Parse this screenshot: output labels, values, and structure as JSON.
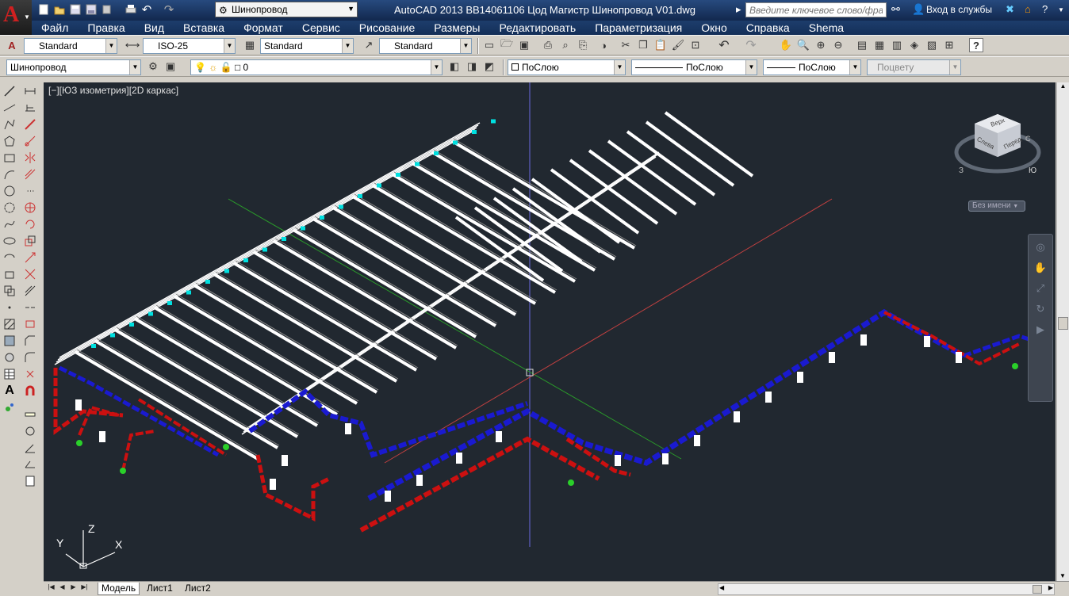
{
  "titlebar": {
    "workspace": "Шинопровод",
    "title": "AutoCAD 2013    BB14061106 Цод Магистр Шинопровод V01.dwg",
    "search_placeholder": "Введите ключевое слово/фразу",
    "sign_in": "Вход в службы"
  },
  "menu": [
    "Файл",
    "Правка",
    "Вид",
    "Вставка",
    "Формат",
    "Сервис",
    "Рисование",
    "Размеры",
    "Редактировать",
    "Параметризация",
    "Окно",
    "Справка",
    "Shema"
  ],
  "styles": {
    "text_style": "Standard",
    "dim_style": "ISO-25",
    "table_style": "Standard",
    "mleader_style": "Standard"
  },
  "layers": {
    "layer_name": "Шинопровод",
    "layer_current": "0",
    "color": "ПоСлою",
    "linetype": "ПоСлою",
    "lineweight": "ПоСлою",
    "plotstyle": "Поцвету"
  },
  "viewport": {
    "label": "[−][ЮЗ изометрия][2D каркас]",
    "viewcube": {
      "top": "Верх",
      "left": "Слева",
      "front": "Перед",
      "compass_s": "С",
      "compass_w": "З",
      "compass_sw": "Ю"
    },
    "named_view": "Без имени",
    "ucs": {
      "x": "X",
      "y": "Y",
      "z": "Z"
    }
  },
  "layout_tabs": [
    "Модель",
    "Лист1",
    "Лист2"
  ],
  "colors": {
    "background": "#212830",
    "feeder": "#1a1ad0",
    "conductor_red": "#cc1010",
    "trunk": "#ffffff",
    "fitting": "#00e0e0"
  }
}
